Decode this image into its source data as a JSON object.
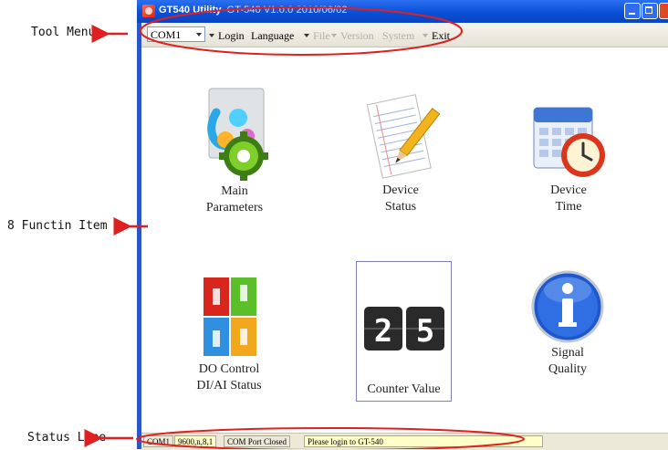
{
  "annotations": {
    "tool_menu": "Tool Menu",
    "function_items": "8 Functin Item",
    "status_line": "Status Line"
  },
  "window": {
    "title": "GT540 Utility",
    "title_version": "GT-540 V1.0.0 2010/06/02"
  },
  "toolbar": {
    "port": "COM1",
    "login": "Login",
    "language": "Language",
    "file": "File",
    "version": "Version",
    "system": "System",
    "exit": "Exit"
  },
  "functions": {
    "main_parameters": [
      "Main",
      "Parameters"
    ],
    "device_status": [
      "Device",
      "Status"
    ],
    "device_time": [
      "Device",
      "Time"
    ],
    "do_control": [
      "DO Control",
      "DI/AI Status"
    ],
    "counter_value": "Counter Value",
    "counter_digits": [
      "2",
      "5"
    ],
    "signal_quality": [
      "Signal",
      "Quality"
    ]
  },
  "statusbar": {
    "port": "COM1",
    "settings": "9600,n,8,1",
    "port_state": "COM Port Closed",
    "message": "Please login to GT-540"
  },
  "colors": {
    "annotation_red": "#e02020",
    "titlebar_blue": "#0a4fd6",
    "status_yellow": "#ffffc8"
  }
}
